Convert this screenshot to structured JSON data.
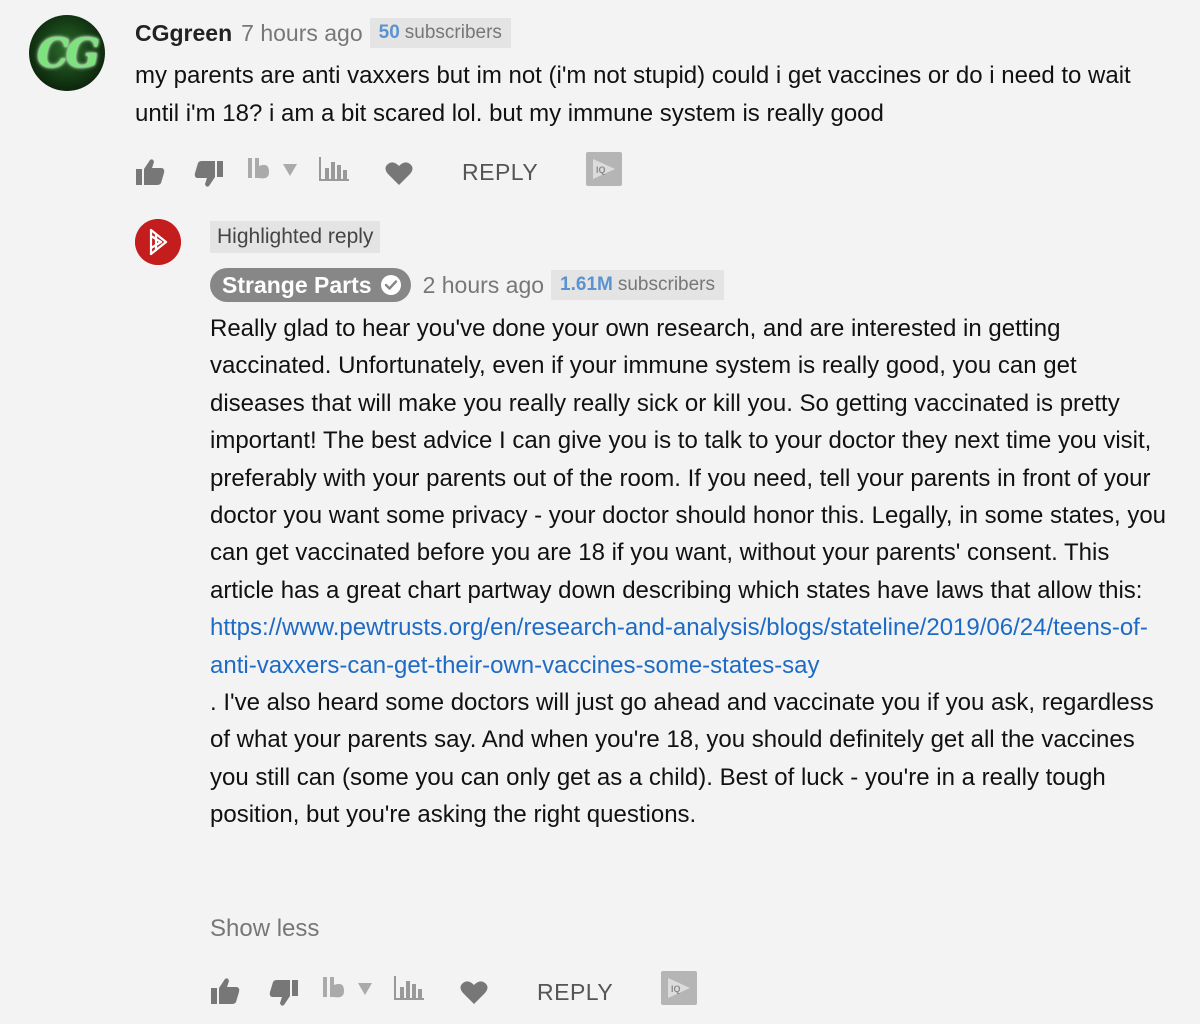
{
  "comment": {
    "author": "CGgreen",
    "time": "7 hours ago",
    "subscribers": {
      "count": "50",
      "label": "subscribers"
    },
    "avatar_text": "CG",
    "text": "my parents are anti vaxxers but im not (i'm not stupid) could i get vaccines or do i need to wait until i'm 18?  i am a bit scared lol. but my immune system is really good",
    "actions": {
      "reply_label": "REPLY"
    }
  },
  "reply": {
    "highlight_label": "Highlighted reply",
    "author": "Strange Parts",
    "time": "2 hours ago",
    "subscribers": {
      "count": "1.61M",
      "label": "subscribers"
    },
    "text_part1": "Really glad to hear you've done your own research, and are interested in getting vaccinated. Unfortunately, even if your immune system is really good, you can get diseases that will make you really really sick or kill you.  So getting vaccinated is pretty important!   The best advice I can give you is to talk to your doctor they next time you visit, preferably with your parents out of the room.  If you need, tell your parents in front of your doctor you want some privacy - your doctor should honor this. Legally, in some states, you can get vaccinated before you are 18 if you want, without your parents' consent.  This article has a great chart partway down describing which states have laws that allow this:",
    "link": "https://www.pewtrusts.org/en/research-and-analysis/blogs/stateline/2019/06/24/teens-of-anti-vaxxers-can-get-their-own-vaccines-some-states-say",
    "text_part2": ".  I've also heard some doctors will just go ahead and vaccinate you if you ask, regardless of what your parents say. And when you're 18, you should definitely get all the vaccines you still can (some you can only get as a child). Best of luck - you're in a really tough position, but you're asking the right questions.",
    "show_less_label": "Show less",
    "actions": {
      "reply_label": "REPLY"
    }
  },
  "colors": {
    "link": "#1e6bc6",
    "badge_number": "#5b93d0",
    "author_pill": "#878787",
    "brand_red": "#c41d1d"
  },
  "icons": [
    "thumbs-up-icon",
    "thumbs-down-icon",
    "tubebuddy-dropdown-icon",
    "stats-icon",
    "heart-icon",
    "tube-icon"
  ]
}
